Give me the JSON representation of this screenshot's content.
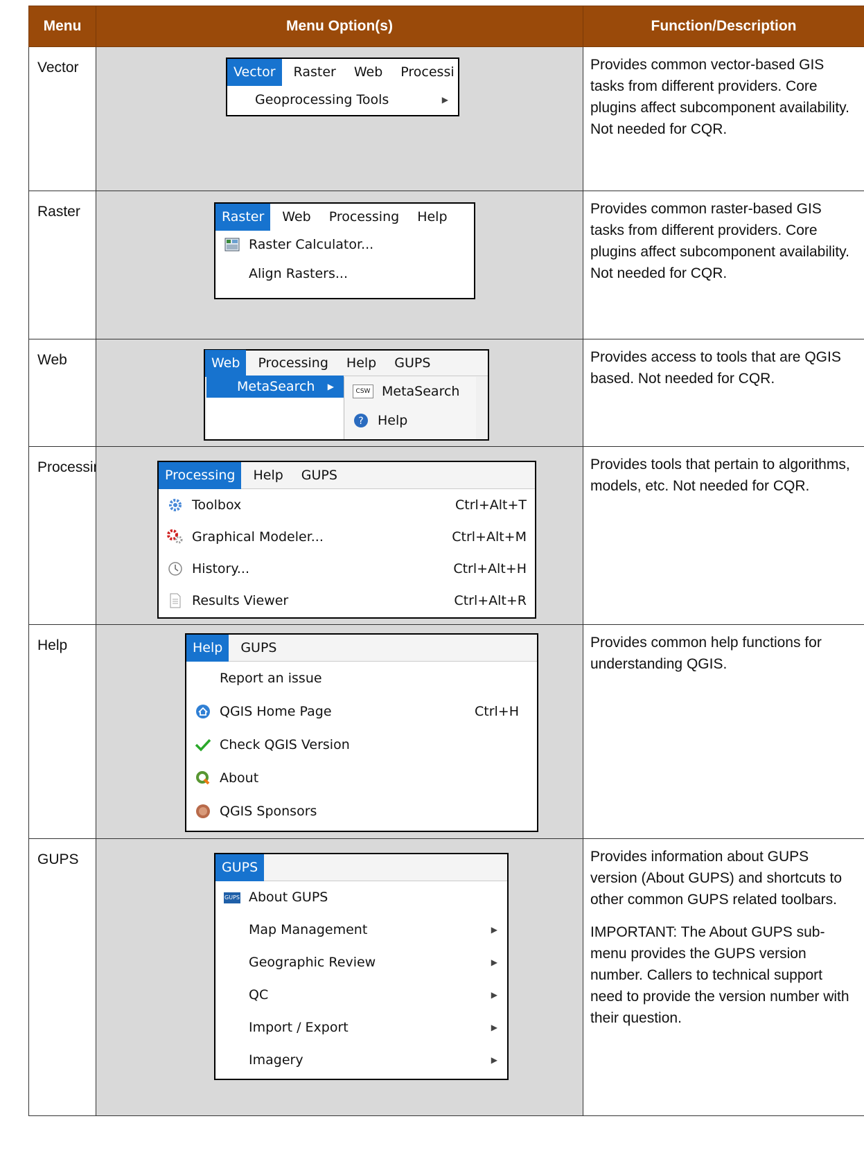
{
  "headers": {
    "menu": "Menu",
    "options": "Menu Option(s)",
    "description": "Function/Description"
  },
  "rows": [
    {
      "menu": "Vector",
      "menubar": [
        "Vector",
        "Raster",
        "Web",
        "Processi"
      ],
      "items": [
        {
          "label": "Geoprocessing Tools",
          "icon": "",
          "submenu": true
        }
      ],
      "description": [
        "Provides common vector-based GIS tasks from different providers. Core plugins affect subcomponent availability. Not needed for CQR."
      ]
    },
    {
      "menu": "Raster",
      "menubar": [
        "Raster",
        "Web",
        "Processing",
        "Help"
      ],
      "items": [
        {
          "label": "Raster Calculator...",
          "icon": "raster-calculator-icon"
        },
        {
          "label": "Align Rasters...",
          "icon": ""
        }
      ],
      "description": [
        "Provides common raster-based GIS tasks from different providers. Core plugins affect subcomponent availability. Not needed for CQR."
      ]
    },
    {
      "menu": "Web",
      "menubar": [
        "Web",
        "Processing",
        "Help",
        "GUPS"
      ],
      "items": [
        {
          "label": "MetaSearch",
          "icon": "",
          "submenu": true
        }
      ],
      "subitems": [
        {
          "label": "MetaSearch",
          "icon": "csw-icon",
          "icon_text": "CSW"
        },
        {
          "label": "Help",
          "icon": "help-icon"
        }
      ],
      "description": [
        "Provides access to tools that are QGIS based. Not needed for CQR."
      ]
    },
    {
      "menu": "Processing",
      "menubar": [
        "Processing",
        "Help",
        "GUPS"
      ],
      "items": [
        {
          "label": "Toolbox",
          "icon": "gear-icon",
          "shortcut": "Ctrl+Alt+T"
        },
        {
          "label": "Graphical Modeler...",
          "icon": "modeler-gears-icon",
          "shortcut": "Ctrl+Alt+M"
        },
        {
          "label": "History...",
          "icon": "clock-icon",
          "shortcut": "Ctrl+Alt+H"
        },
        {
          "label": "Results Viewer",
          "icon": "document-icon",
          "shortcut": "Ctrl+Alt+R"
        }
      ],
      "description": [
        "Provides tools that pertain to algorithms, models, etc. Not needed for CQR."
      ]
    },
    {
      "menu": "Help",
      "menubar": [
        "Help",
        "GUPS"
      ],
      "items": [
        {
          "label": "Report an issue",
          "icon": ""
        },
        {
          "label": "QGIS Home Page",
          "icon": "home-icon",
          "shortcut": "Ctrl+H"
        },
        {
          "label": "Check QGIS Version",
          "icon": "checkmark-icon"
        },
        {
          "label": "About",
          "icon": "qgis-logo-icon"
        },
        {
          "label": "QGIS Sponsors",
          "icon": "sponsors-icon"
        }
      ],
      "description": [
        "Provides common help functions for understanding QGIS."
      ]
    },
    {
      "menu": "GUPS",
      "menubar": [
        "GUPS"
      ],
      "items": [
        {
          "label": "About GUPS",
          "icon": "gups-icon",
          "icon_text": "GUPS"
        },
        {
          "label": "Map Management",
          "icon": "",
          "submenu": true
        },
        {
          "label": "Geographic Review",
          "icon": "",
          "submenu": true
        },
        {
          "label": "QC",
          "icon": "",
          "submenu": true
        },
        {
          "label": "Import / Export",
          "icon": "",
          "submenu": true
        },
        {
          "label": "Imagery",
          "icon": "",
          "submenu": true
        }
      ],
      "description": [
        "Provides information about GUPS version (About GUPS) and shortcuts to other common GUPS related toolbars.",
        "IMPORTANT: The About GUPS sub-menu provides the GUPS version number. Callers to technical support need to provide the version number with their question."
      ]
    }
  ],
  "colors": {
    "header_bg": "#9a4a0a",
    "options_bg": "#d9d9d9",
    "menu_highlight": "#1773cf"
  }
}
